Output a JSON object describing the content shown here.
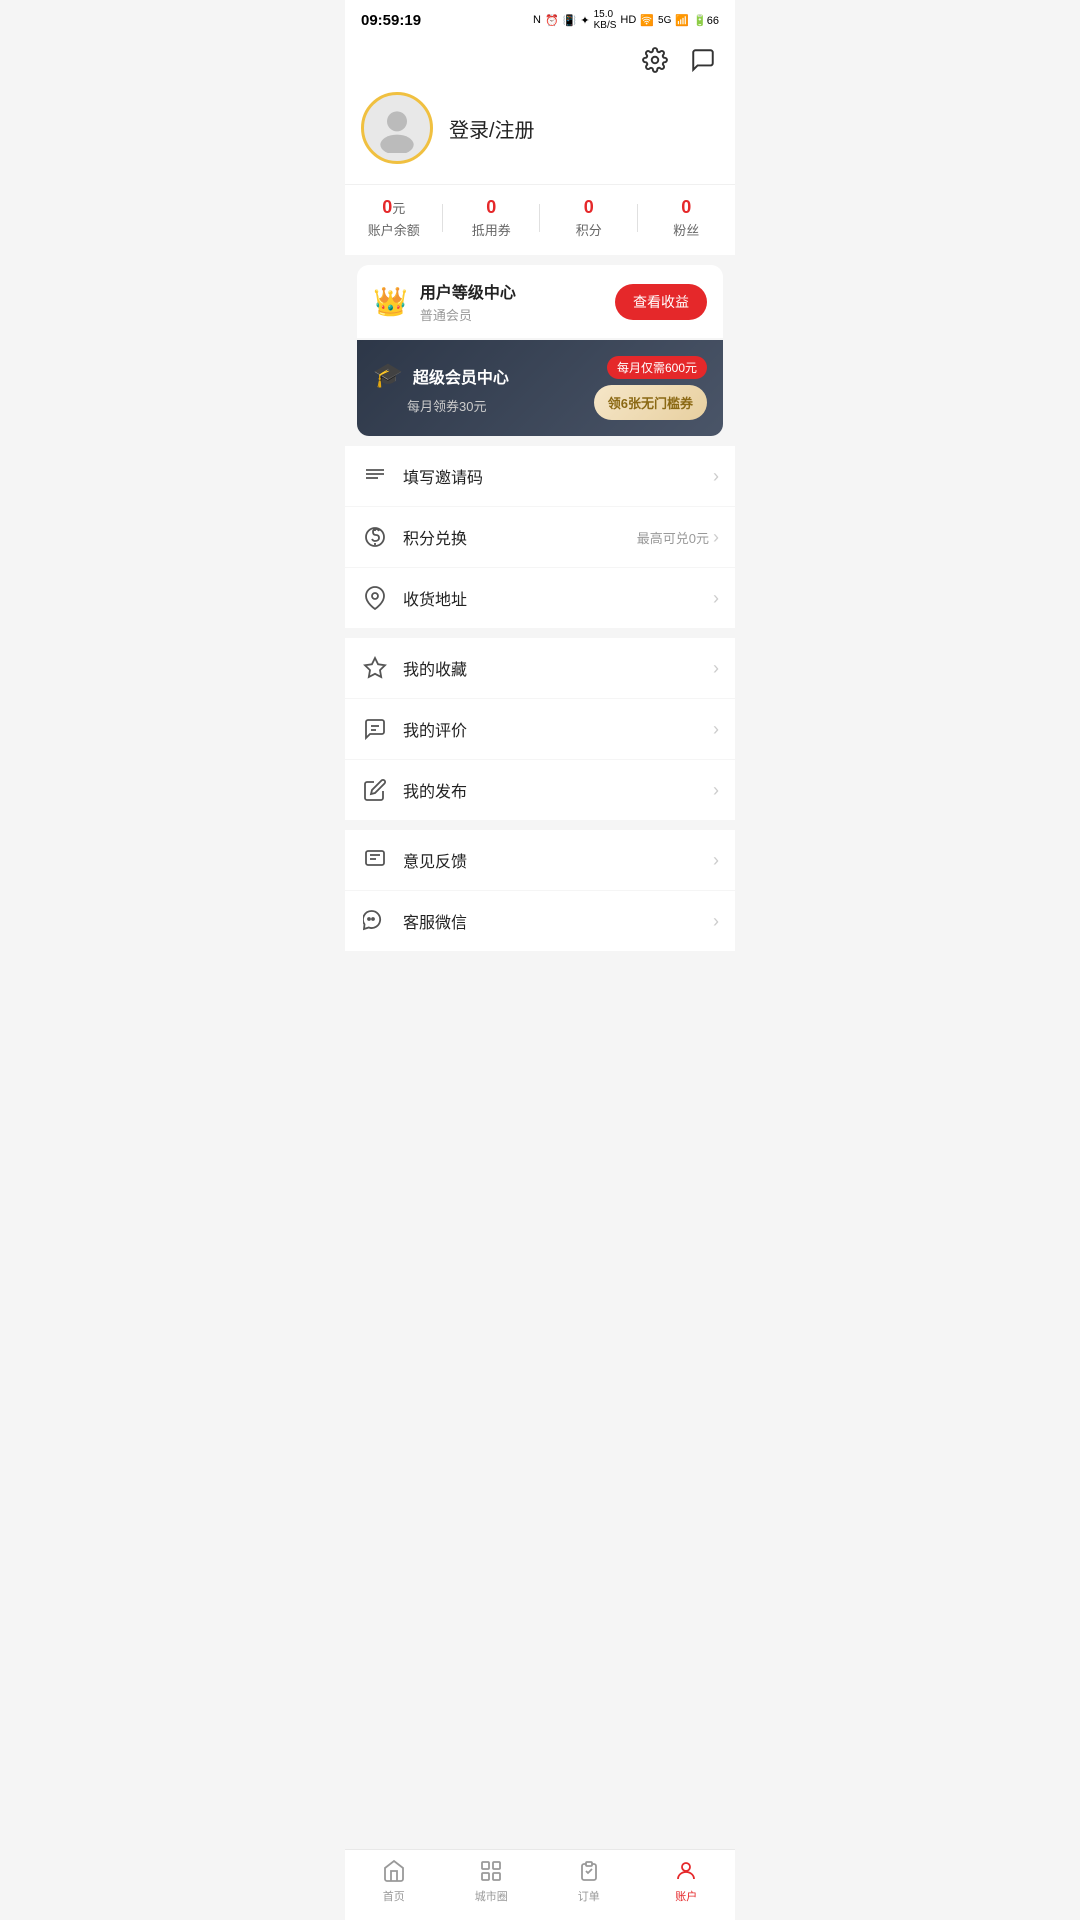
{
  "statusBar": {
    "time": "09:59:19",
    "icons": "NFC ⏰ 📳 ✦ 15.0KB/s HD 🛜 5G 📶 66%"
  },
  "header": {
    "settingsLabel": "设置",
    "messageLabel": "消息"
  },
  "profile": {
    "loginText": "登录/注册",
    "avatarAlt": "avatar"
  },
  "stats": [
    {
      "value": "0",
      "unit": "元",
      "label": "账户余额"
    },
    {
      "value": "0",
      "unit": "",
      "label": "抵用券"
    },
    {
      "value": "0",
      "unit": "",
      "label": "积分"
    },
    {
      "value": "0",
      "unit": "",
      "label": "粉丝"
    }
  ],
  "levelCard": {
    "title": "用户等级中心",
    "subtitle": "普通会员",
    "btnLabel": "查看收益"
  },
  "superMemberCard": {
    "title": "超级会员中心",
    "subtitle": "每月领券30元",
    "priceBadge": "每月仅需600元",
    "couponBtn": "领6张无门槛券"
  },
  "menuItems": [
    {
      "id": "invite-code",
      "label": "填写邀请码",
      "sub": "",
      "iconType": "list"
    },
    {
      "id": "points-exchange",
      "label": "积分兑换",
      "sub": "最高可兑0元",
      "iconType": "exchange"
    },
    {
      "id": "shipping-address",
      "label": "收货地址",
      "sub": "",
      "iconType": "location"
    },
    {
      "id": "my-favorites",
      "label": "我的收藏",
      "sub": "",
      "iconType": "star"
    },
    {
      "id": "my-reviews",
      "label": "我的评价",
      "sub": "",
      "iconType": "comment"
    },
    {
      "id": "my-publish",
      "label": "我的发布",
      "sub": "",
      "iconType": "edit"
    },
    {
      "id": "feedback",
      "label": "意见反馈",
      "sub": "",
      "iconType": "feedback"
    },
    {
      "id": "wechat-service",
      "label": "客服微信",
      "sub": "",
      "iconType": "wechat"
    }
  ],
  "bottomNav": [
    {
      "id": "home",
      "label": "首页",
      "active": false
    },
    {
      "id": "city-circle",
      "label": "城市圈",
      "active": false
    },
    {
      "id": "orders",
      "label": "订单",
      "active": false
    },
    {
      "id": "account",
      "label": "账户",
      "active": true
    }
  ]
}
